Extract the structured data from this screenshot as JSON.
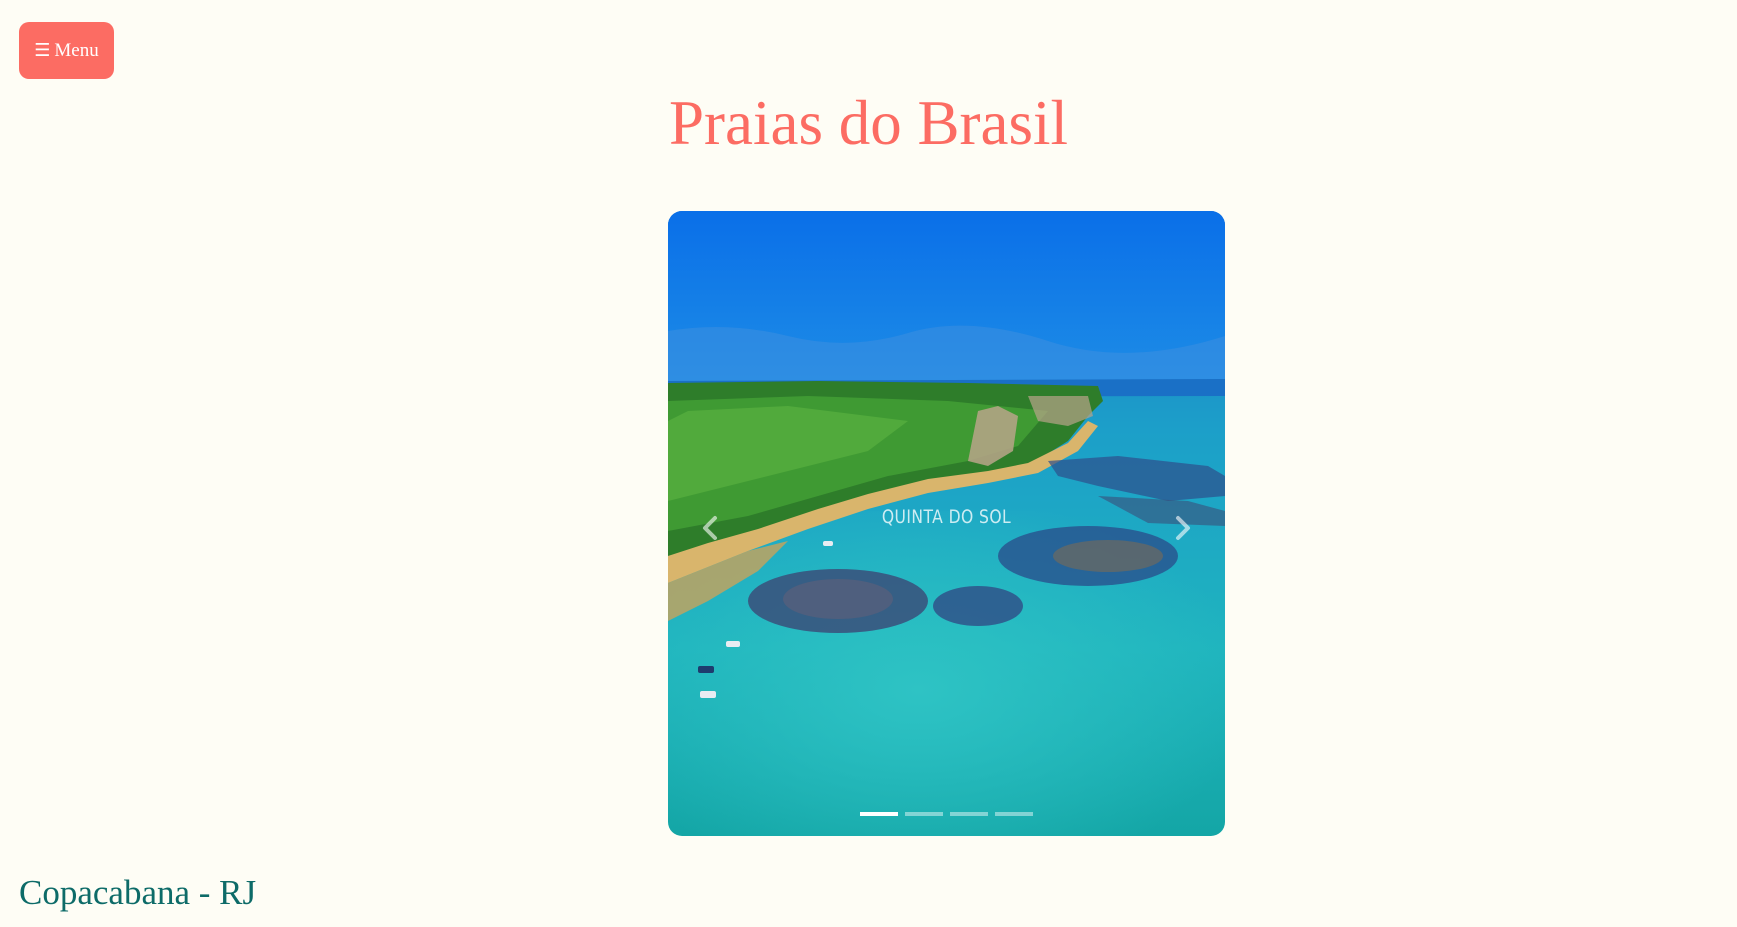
{
  "header": {
    "menu_icon": "hamburger-icon",
    "menu_label": "Menu",
    "title": "Praias do Brasil"
  },
  "carousel": {
    "caption": "QUINTA DO SOL",
    "slide_count": 4,
    "active_index": 0,
    "prev_icon": "chevron-left-icon",
    "next_icon": "chevron-right-icon"
  },
  "section": {
    "heading": "Copacabana - RJ"
  },
  "colors": {
    "accent": "#fc6c63",
    "background": "#fefdf5",
    "heading_teal": "#0d6b68"
  }
}
